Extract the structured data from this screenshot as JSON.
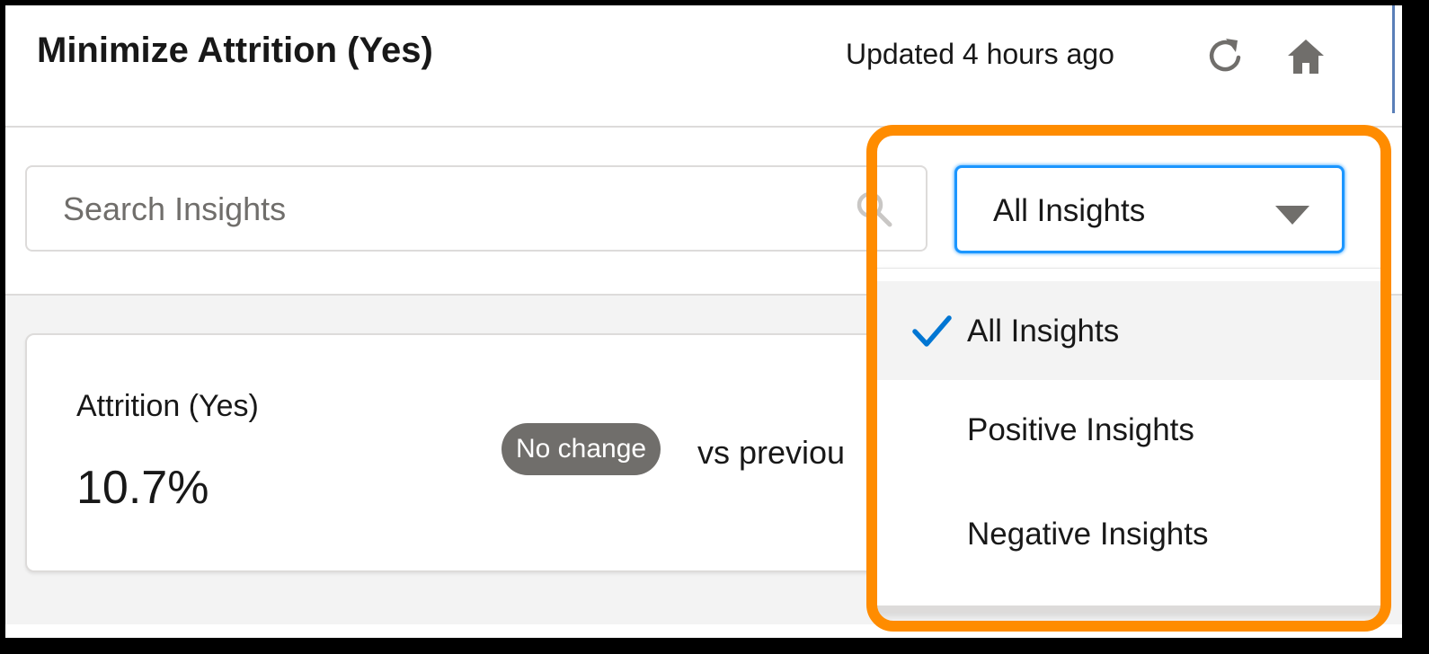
{
  "header": {
    "title": "Minimize Attrition (Yes)",
    "updated": "Updated 4 hours ago",
    "refresh_icon": "refresh-icon",
    "home_icon": "home-icon"
  },
  "toolbar": {
    "search": {
      "placeholder": "Search Insights",
      "value": "",
      "icon": "search-icon"
    },
    "filter": {
      "selected": "All Insights",
      "options": [
        "All Insights",
        "Positive Insights",
        "Negative Insights"
      ]
    }
  },
  "card": {
    "metric_label": "Attrition (Yes)",
    "metric_value": "10.7%",
    "badge": "No change",
    "comparison": "vs previou"
  },
  "colors": {
    "accent": "#1b96ff",
    "highlight": "#ff8c00",
    "badge": "#706e6b",
    "check": "#0176d3"
  }
}
